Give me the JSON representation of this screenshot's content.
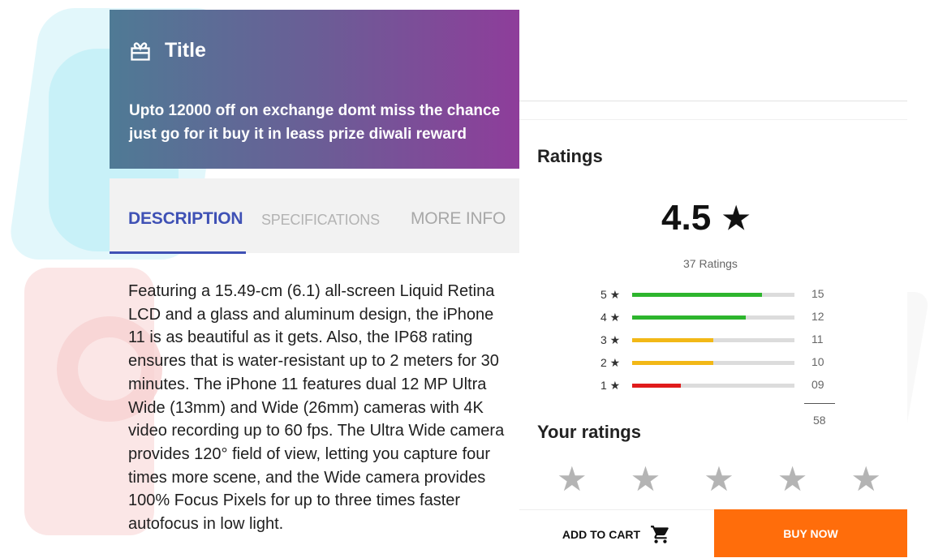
{
  "banner": {
    "title": "Title",
    "text": "Upto 12000 off on exchange domt miss the chance just go for it buy it in leass prize diwali reward"
  },
  "tabs": [
    {
      "label": "DESCRIPTION",
      "active": true
    },
    {
      "label": "SPECIFICATIONS",
      "active": false
    },
    {
      "label": "MORE INFO",
      "active": false
    }
  ],
  "description": "Featuring a 15.49-cm (6.1) all-screen Liquid Retina LCD and a glass and aluminum design, the iPhone 11 is as beautiful as it gets. Also, the IP68 rating ensures that is water-resistant up to 2 meters for 30 minutes. The iPhone 11 features dual 12 MP Ultra Wide (13mm) and Wide (26mm) cameras with 4K video recording up to 60 fps. The Ultra Wide camera provides 120° field of view, letting you capture four times more scene, and the Wide camera provides 100% Focus Pixels for up to three times faster autofocus in low light.",
  "ratings": {
    "heading": "Ratings",
    "average": "4.5",
    "star_glyph": "★",
    "count_text": "37 Ratings",
    "breakdown": [
      {
        "label": "5 ★",
        "count": "15",
        "fill": 0.8,
        "color": "#2db52d"
      },
      {
        "label": "4 ★",
        "count": "12",
        "fill": 0.7,
        "color": "#2db52d"
      },
      {
        "label": "3 ★",
        "count": "11",
        "fill": 0.5,
        "color": "#f2b817"
      },
      {
        "label": "2 ★",
        "count": "10",
        "fill": 0.5,
        "color": "#f2b817"
      },
      {
        "label": "1 ★",
        "count": "09",
        "fill": 0.3,
        "color": "#e01b1b"
      }
    ],
    "total": "58"
  },
  "your_ratings": {
    "heading": "Your ratings",
    "stars": [
      "★",
      "★",
      "★",
      "★",
      "★"
    ]
  },
  "actions": {
    "add_to_cart": "ADD TO CART",
    "buy_now": "BUY NOW",
    "cart_icon": "shopping-cart-icon"
  },
  "colors": {
    "accent": "#3f51b5",
    "buy": "#ff6d0b"
  }
}
